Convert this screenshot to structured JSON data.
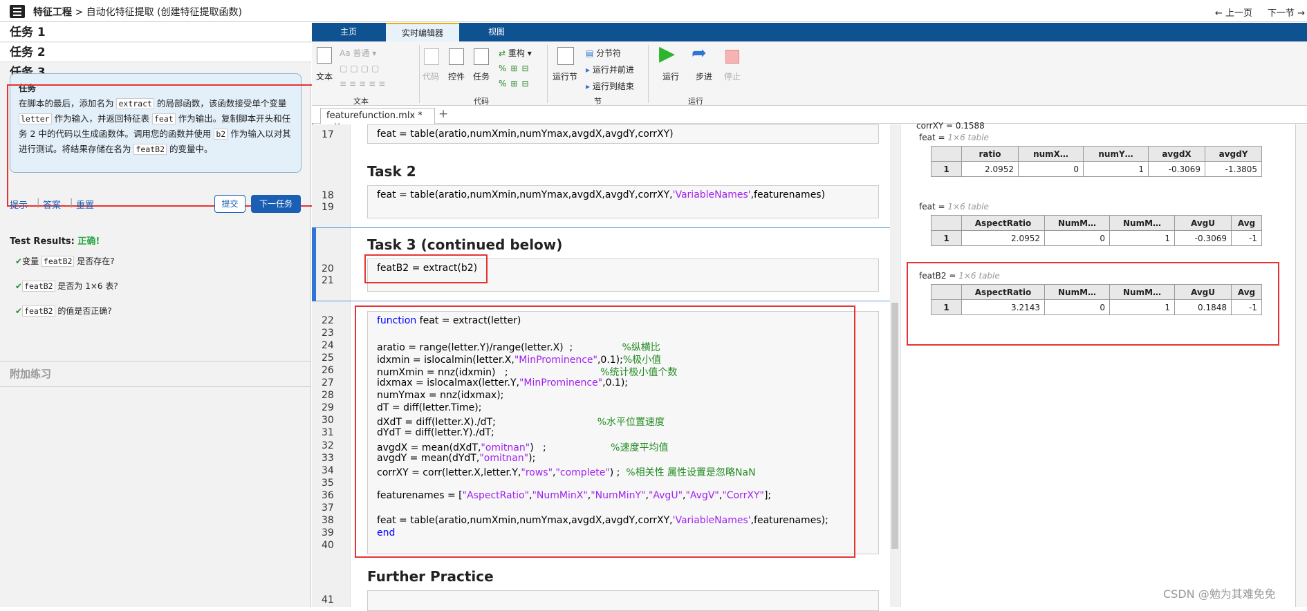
{
  "header": {
    "menu_icon": "hamburger-menu-icon",
    "crumb_root": "特征工程",
    "crumb_sep": ">",
    "crumb_page": "自动化特征提取 (创建特征提取函数)",
    "prev_label": "← 上一页",
    "next_label": "下一节 →"
  },
  "sidebar": {
    "tasks": [
      "任务 1",
      "任务 2",
      "任务 3"
    ],
    "task_title": "任务",
    "task_text": [
      {
        "t": "在脚本的最后，添加名为 "
      },
      {
        "c": "extract"
      },
      {
        "t": " 的局部函数，该函数接受单个变量 "
      },
      {
        "c": "letter"
      },
      {
        "t": " 作为输入，并返回特征表 "
      },
      {
        "c": "feat"
      },
      {
        "t": " 作为输出。复制脚本开头和任务 2 中的代码以生成函数体。调用您的函数并使用 "
      },
      {
        "c": "b2"
      },
      {
        "t": " 作为输入以对其进行测试。将结果存储在名为 "
      },
      {
        "c": "featB2"
      },
      {
        "t": " 的变量中。"
      }
    ],
    "links": [
      "提示",
      "答案",
      "重置"
    ],
    "submit": "提交",
    "next_task": "下一任务",
    "results_label": "Test Results:",
    "results_status": "正确!",
    "checks": [
      {
        "pre": "变量 ",
        "code": "featB2",
        "post": " 是否存在?"
      },
      {
        "pre": "",
        "code": "featB2",
        "post": " 是否为 1×6 表?"
      },
      {
        "pre": "",
        "code": "featB2",
        "post": " 的值是否正确?"
      }
    ],
    "extra": "附加练习"
  },
  "ribbon": {
    "tabs": [
      "主页",
      "实时编辑器",
      "视图"
    ],
    "active_tab": 1,
    "text_btn": "文本",
    "style_dropdown": "普通",
    "code_btn": "代码",
    "control_btn": "控件",
    "task_btn": "任务",
    "refactor_btn": "重构",
    "run_section_btn": "运行节",
    "section_break": "分节符",
    "run_and_advance": "运行并前进",
    "run_to_end": "运行到结束",
    "run_btn": "运行",
    "step_btn": "步进",
    "stop_btn": "停止",
    "sections": [
      "文本",
      "代码",
      "节",
      "运行"
    ],
    "colors": {
      "tab_bar": "#0f5291",
      "accent": "#f0ad00"
    }
  },
  "file_tab": {
    "name": "featurefunction.mlx *",
    "close": "×",
    "add": "+"
  },
  "editor": {
    "line_17": "17",
    "code_17": "feat = table(aratio,numXmin,numYmax,avgdX,avgdY,corrXY)",
    "heading_task2": "Task 2",
    "lines_18_19": [
      "18",
      "19"
    ],
    "code_18_pre": "feat = table(aratio,numXmin,numYmax,avgdX,avgdY,corrXY,",
    "code_18_str": "'VariableNames'",
    "code_18_post": ",featurenames)",
    "heading_task3": "Task 3 (continued below)",
    "lines_20_21": [
      "20",
      "21"
    ],
    "code_20": "featB2 = extract(b2)",
    "func_lines": [
      "22",
      "23",
      "24",
      "25",
      "26",
      "27",
      "28",
      "29",
      "30",
      "31",
      "32",
      "33",
      "34",
      "35",
      "36",
      "37",
      "38",
      "39",
      "40"
    ],
    "func_code": [
      [
        {
          "k": "kw",
          "v": "function"
        },
        {
          "k": "",
          "v": " feat = extract(letter)"
        }
      ],
      [],
      [
        {
          "k": "",
          "v": "aratio = range(letter.Y)/range(letter.X)  ;                "
        },
        {
          "k": "cm",
          "v": "%纵横比"
        }
      ],
      [
        {
          "k": "",
          "v": "idxmin = islocalmin(letter.X,"
        },
        {
          "k": "str",
          "v": "\"MinProminence\""
        },
        {
          "k": "",
          "v": ",0.1);"
        },
        {
          "k": "cm",
          "v": "%极小值"
        }
      ],
      [
        {
          "k": "",
          "v": "numXmin = nnz(idxmin)   ;                              "
        },
        {
          "k": "cm",
          "v": "%统计极小值个数"
        }
      ],
      [
        {
          "k": "",
          "v": "idxmax = islocalmax(letter.Y,"
        },
        {
          "k": "str",
          "v": "\"MinProminence\""
        },
        {
          "k": "",
          "v": ",0.1);"
        }
      ],
      [
        {
          "k": "",
          "v": "numYmax = nnz(idxmax);"
        }
      ],
      [
        {
          "k": "",
          "v": "dT = diff(letter.Time);"
        }
      ],
      [
        {
          "k": "",
          "v": "dXdT = diff(letter.X)./dT;                                 "
        },
        {
          "k": "cm",
          "v": "%水平位置速度"
        }
      ],
      [
        {
          "k": "",
          "v": "dYdT = diff(letter.Y)./dT;"
        }
      ],
      [
        {
          "k": "",
          "v": "avgdX = mean(dXdT,"
        },
        {
          "k": "str",
          "v": "\"omitnan\""
        },
        {
          "k": "",
          "v": ")   ;                     "
        },
        {
          "k": "cm",
          "v": "%速度平均值"
        }
      ],
      [
        {
          "k": "",
          "v": "avgdY = mean(dYdT,"
        },
        {
          "k": "str",
          "v": "\"omitnan\""
        },
        {
          "k": "",
          "v": ");"
        }
      ],
      [
        {
          "k": "",
          "v": "corrXY = corr(letter.X,letter.Y,"
        },
        {
          "k": "str",
          "v": "\"rows\""
        },
        {
          "k": "",
          "v": ","
        },
        {
          "k": "str",
          "v": "\"complete\""
        },
        {
          "k": "",
          "v": ") ;  "
        },
        {
          "k": "cm",
          "v": "%相关性 属性设置是忽略NaN"
        }
      ],
      [],
      [
        {
          "k": "",
          "v": "featurenames = ["
        },
        {
          "k": "str",
          "v": "\"AspectRatio\""
        },
        {
          "k": "",
          "v": ","
        },
        {
          "k": "str",
          "v": "\"NumMinX\""
        },
        {
          "k": "",
          "v": ","
        },
        {
          "k": "str",
          "v": "\"NumMinY\""
        },
        {
          "k": "",
          "v": ","
        },
        {
          "k": "str",
          "v": "\"AvgU\""
        },
        {
          "k": "",
          "v": ","
        },
        {
          "k": "str",
          "v": "\"AvgV\""
        },
        {
          "k": "",
          "v": ","
        },
        {
          "k": "str",
          "v": "\"CorrXY\""
        },
        {
          "k": "",
          "v": "];"
        }
      ],
      [],
      [
        {
          "k": "",
          "v": "feat = table(aratio,numXmin,numYmax,avgdX,avgdY,corrXY,"
        },
        {
          "k": "str",
          "v": "'VariableNames'"
        },
        {
          "k": "",
          "v": ",featurenames);"
        }
      ],
      [
        {
          "k": "kw",
          "v": "end"
        }
      ],
      []
    ],
    "heading_further": "Further Practice",
    "line_41": "41"
  },
  "output": {
    "corr_line": "corrXY = 0.1588",
    "tables": [
      {
        "name": "feat =",
        "size": "1×6 table",
        "headers": [
          "ratio",
          "numX…",
          "numY…",
          "avgdX",
          "avgdY"
        ],
        "row": "1",
        "values": [
          "2.0952",
          "0",
          "1",
          "-0.3069",
          "-1.3805"
        ]
      },
      {
        "name": "feat =",
        "size": "1×6 table",
        "headers": [
          "AspectRatio",
          "NumM…",
          "NumM…",
          "AvgU",
          "Avg"
        ],
        "row": "1",
        "values": [
          "2.0952",
          "0",
          "1",
          "-0.3069",
          "-1"
        ]
      },
      {
        "name": "featB2 =",
        "size": "1×6 table",
        "headers": [
          "AspectRatio",
          "NumM…",
          "NumM…",
          "AvgU",
          "Avg"
        ],
        "row": "1",
        "values": [
          "3.2143",
          "0",
          "1",
          "0.1848",
          "-1"
        ]
      }
    ]
  },
  "watermark": "CSDN @勉为其难免免"
}
